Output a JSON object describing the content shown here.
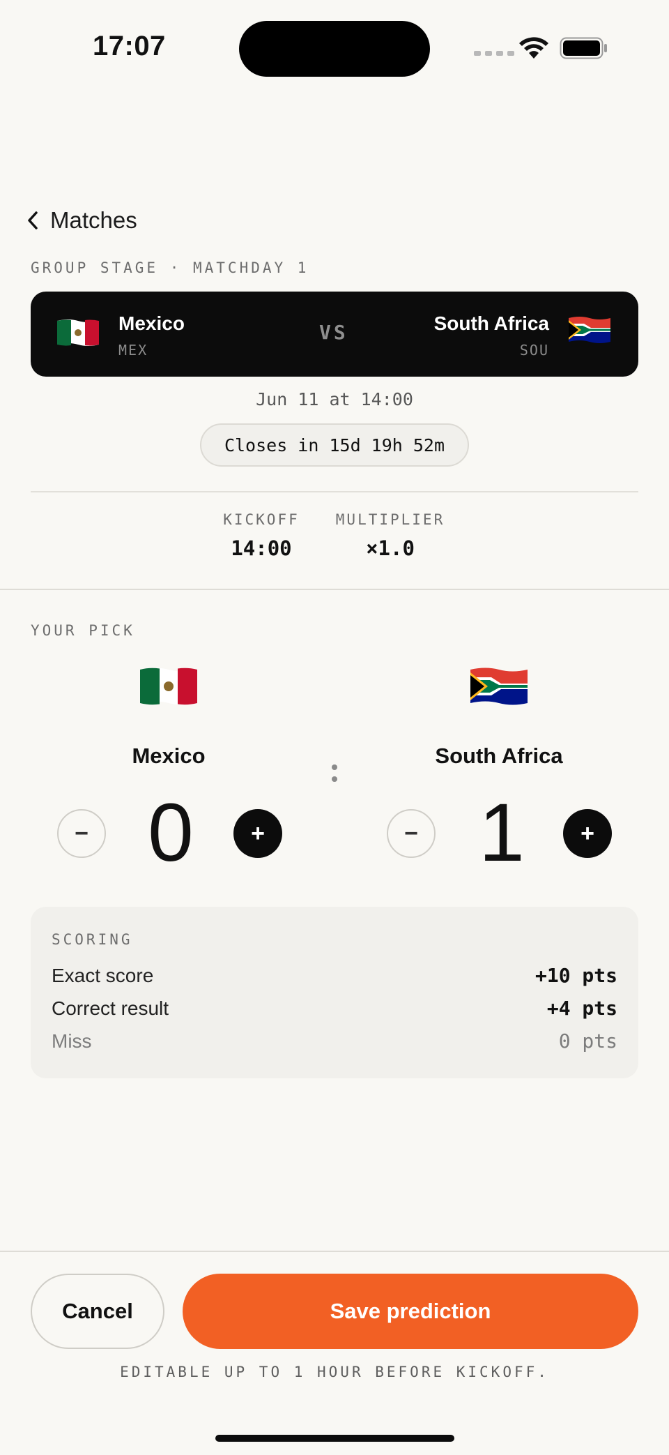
{
  "status_bar": {
    "time": "17:07"
  },
  "nav": {
    "back_label": "Matches"
  },
  "stage": "GROUP STAGE · MATCHDAY 1",
  "match": {
    "home": {
      "name": "Mexico",
      "code": "MEX",
      "flag": "mexico-flag"
    },
    "away": {
      "name": "South Africa",
      "code": "SOU",
      "flag": "south-africa-flag"
    },
    "vs_label": "VS",
    "date": "Jun 11 at 14:00",
    "closes": "Closes in 15d 19h 52m"
  },
  "stats": {
    "kickoff_label": "KICKOFF",
    "kickoff_value": "14:00",
    "multiplier_label": "MULTIPLIER",
    "multiplier_value": "×1.0"
  },
  "pick": {
    "section_label": "YOUR PICK",
    "home_name": "Mexico",
    "away_name": "South Africa",
    "home_score": "0",
    "away_score": "1",
    "minus": "−",
    "plus": "+"
  },
  "scoring": {
    "title": "SCORING",
    "rows": [
      {
        "label": "Exact score",
        "value": "+10 pts"
      },
      {
        "label": "Correct result",
        "value": "+4 pts"
      },
      {
        "label": "Miss",
        "value": "0 pts"
      }
    ]
  },
  "actions": {
    "cancel": "Cancel",
    "save": "Save prediction",
    "footnote": "EDITABLE UP TO 1 HOUR BEFORE KICKOFF."
  },
  "colors": {
    "accent": "#f26024",
    "card": "#0c0c0c",
    "background": "#f9f8f4"
  }
}
